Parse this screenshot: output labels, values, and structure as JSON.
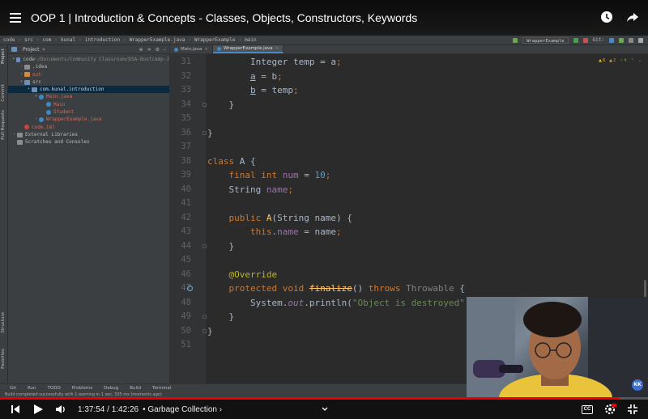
{
  "video": {
    "title": "OOP 1 | Introduction & Concepts - Classes, Objects, Constructors, Keywords",
    "current_time": "1:37:54",
    "duration": "1:42:26",
    "separator": " / ",
    "chapter": "• Garbage Collection ›",
    "progress_fraction": 0.956
  },
  "ide": {
    "breadcrumb": [
      "code",
      "src",
      "com",
      "kunal",
      "introduction",
      "WrapperExample.java",
      "WrapperExample",
      "main"
    ],
    "run_config": "WrapperExample",
    "git_label": "Git:",
    "project_header": "Project",
    "side_tabs": [
      "Project",
      "Commit",
      "Pull Requests",
      "Structure",
      "Favorites"
    ],
    "tree": [
      {
        "indent": 0,
        "twisty": "▾",
        "icon": "blue",
        "label": "code",
        "extra": " ~/Documents/Community Classroom/DSA-Bootcamp-J",
        "style": "normal"
      },
      {
        "indent": 1,
        "twisty": "›",
        "icon": "gray",
        "label": ".idea",
        "style": "normal"
      },
      {
        "indent": 1,
        "twisty": "›",
        "icon": "orange",
        "label": "out",
        "style": "red"
      },
      {
        "indent": 1,
        "twisty": "▾",
        "icon": "blue",
        "label": "src",
        "style": "normal"
      },
      {
        "indent": 2,
        "twisty": "▾",
        "icon": "blue",
        "label": "com.kunal.introduction",
        "style": "hl",
        "selected": true
      },
      {
        "indent": 3,
        "twisty": "▾",
        "icon": "cyan",
        "label": "Main.java",
        "style": "red"
      },
      {
        "indent": 4,
        "twisty": "",
        "icon": "cyan",
        "label": "Main",
        "style": "red"
      },
      {
        "indent": 4,
        "twisty": "",
        "icon": "cyan",
        "label": "Student",
        "style": "red"
      },
      {
        "indent": 3,
        "twisty": "›",
        "icon": "cyan",
        "label": "WrapperExample.java",
        "style": "red"
      },
      {
        "indent": 1,
        "twisty": "",
        "icon": "red",
        "label": "code.iml",
        "style": "red"
      },
      {
        "indent": 0,
        "twisty": "›",
        "icon": "gray",
        "label": "External Libraries",
        "style": "normal"
      },
      {
        "indent": 0,
        "twisty": "",
        "icon": "gray",
        "label": "Scratches and Consoles",
        "style": "normal"
      }
    ],
    "tabs": [
      {
        "label": "Main.java",
        "active": false
      },
      {
        "label": "WrapperExample.java",
        "active": true
      }
    ],
    "inspections": {
      "warnings": "6",
      "weak": "2",
      "typos": "4"
    },
    "code_lines": [
      {
        "n": "31",
        "html": "        <span>Integer temp = a</span><span class='kw'>;</span>"
      },
      {
        "n": "32",
        "html": "        <span class='ul'>a</span> = b<span class='kw'>;</span>"
      },
      {
        "n": "33",
        "html": "        <span class='ul'>b</span> = temp<span class='kw'>;</span>"
      },
      {
        "n": "34",
        "html": "    }"
      },
      {
        "n": "35",
        "html": ""
      },
      {
        "n": "36",
        "html": "}"
      },
      {
        "n": "37",
        "html": ""
      },
      {
        "n": "38",
        "html": "<span class='kw'>class</span> A {"
      },
      {
        "n": "39",
        "html": "    <span class='kw'>final int</span> <span class='fld'>num</span> = <span class='num'>10</span><span class='kw'>;</span>"
      },
      {
        "n": "40",
        "html": "    String <span class='fld'>name</span><span class='kw'>;</span>"
      },
      {
        "n": "41",
        "html": ""
      },
      {
        "n": "42",
        "html": "    <span class='kw'>public</span> <span class='fn'>A</span>(String name) {"
      },
      {
        "n": "43",
        "html": "        <span class='kw'>this</span>.<span class='fld'>name</span> = name<span class='kw'>;</span>"
      },
      {
        "n": "44",
        "html": "    }"
      },
      {
        "n": "45",
        "html": ""
      },
      {
        "n": "46",
        "html": "    <span class='ann'>@Override</span>"
      },
      {
        "n": "47",
        "html": "    <span class='kw'>protected void</span> <span class='fn strike'>finalize</span>() <span class='kw'>throws</span> <span class='grayt'>Throwable</span> {"
      },
      {
        "n": "48",
        "html": "        System.<span class='fldi'>out</span>.println(<span class='str'>\"Object is destroyed\"</span>)<span class='kw'>;</span>"
      },
      {
        "n": "49",
        "html": "    }"
      },
      {
        "n": "50",
        "html": "}"
      },
      {
        "n": "51",
        "html": ""
      }
    ],
    "bottom_tools": [
      "Git",
      "Run",
      "TODO",
      "Problems",
      "Debug",
      "Build",
      "Terminal"
    ],
    "status_text": "Build completed successfully with 1 warning in 1 sec, 335 ms (moments ago)"
  },
  "webcam_badge": "KK",
  "colors": {
    "progress": "#ee0000",
    "accent": "#4a88c7"
  }
}
